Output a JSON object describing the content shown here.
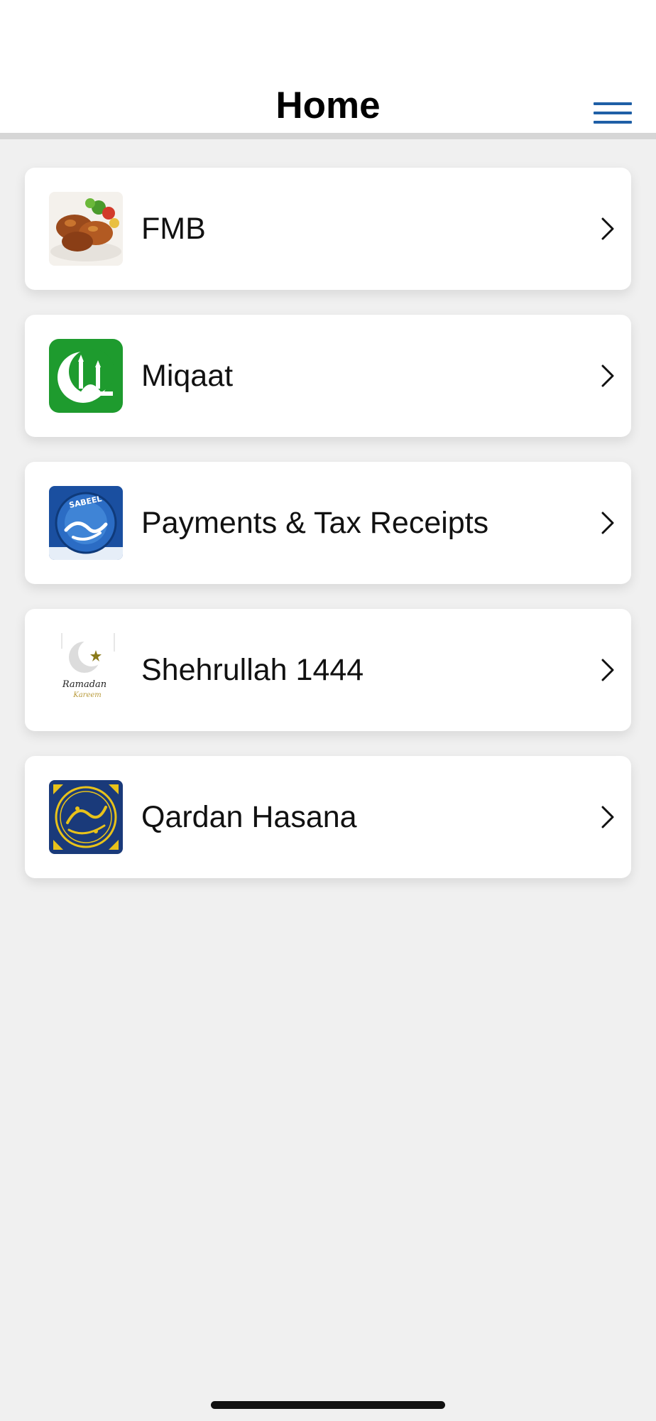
{
  "header": {
    "title": "Home",
    "menu_icon": "hamburger-menu-icon",
    "accent_color": "#1f5fa6"
  },
  "menu_items": [
    {
      "label": "FMB",
      "icon": "fmb-food-thumbnail"
    },
    {
      "label": "Miqaat",
      "icon": "miqaat-mosque-crescent-icon"
    },
    {
      "label": "Payments & Tax Receipts",
      "icon": "sabeel-logo-icon",
      "icon_text": "SABEEL"
    },
    {
      "label": "Shehrullah 1444",
      "icon": "ramadan-kareem-icon",
      "icon_text": "Ramadan Kareem"
    },
    {
      "label": "Qardan Hasana",
      "icon": "qardan-hasana-calligraphy-icon"
    }
  ],
  "colors": {
    "background": "#f0f0f0",
    "card": "#ffffff",
    "miqaat_green": "#1e9b2e",
    "sabeel_blue": "#1a4fa0",
    "qardan_navy": "#1a3a7a",
    "qardan_gold": "#e8c21a"
  }
}
